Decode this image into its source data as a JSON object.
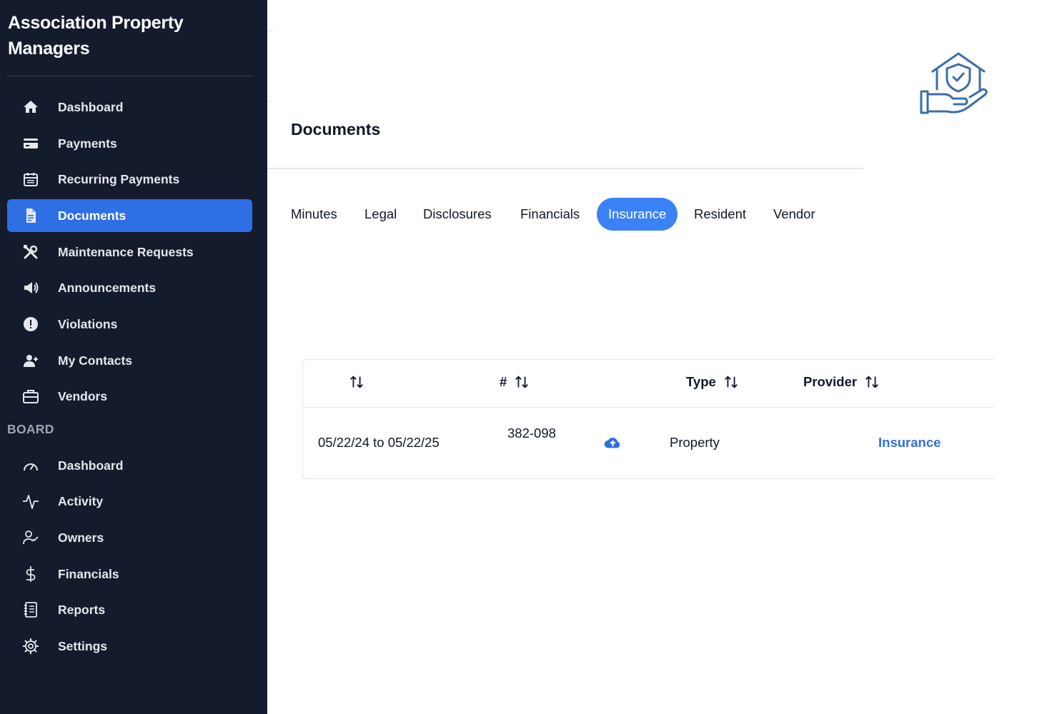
{
  "app": {
    "title": "Association Property Managers"
  },
  "sidebar": {
    "items": [
      {
        "label": "Dashboard",
        "icon": "home-icon"
      },
      {
        "label": "Payments",
        "icon": "credit-card-icon"
      },
      {
        "label": "Recurring Payments",
        "icon": "calendar-icon"
      },
      {
        "label": "Documents",
        "icon": "document-icon",
        "active": true
      },
      {
        "label": "Maintenance Requests",
        "icon": "wrench-screwdriver-icon"
      },
      {
        "label": "Announcements",
        "icon": "megaphone-icon"
      },
      {
        "label": "Violations",
        "icon": "alert-circle-icon"
      },
      {
        "label": "My Contacts",
        "icon": "user-plus-icon"
      },
      {
        "label": "Vendors",
        "icon": "briefcase-icon"
      }
    ],
    "board_section_label": "BOARD",
    "board_items": [
      {
        "label": "Dashboard",
        "icon": "gauge-icon"
      },
      {
        "label": "Activity",
        "icon": "activity-icon"
      },
      {
        "label": "Owners",
        "icon": "user-check-icon"
      },
      {
        "label": "Financials",
        "icon": "dollar-icon"
      },
      {
        "label": "Reports",
        "icon": "notebook-icon"
      },
      {
        "label": "Settings",
        "icon": "gear-icon"
      }
    ]
  },
  "main": {
    "page_title": "Documents",
    "tabs": [
      {
        "label": "Minutes"
      },
      {
        "label": "Legal"
      },
      {
        "label": "Disclosures"
      },
      {
        "label": "Financials"
      },
      {
        "label": "Insurance",
        "active": true
      },
      {
        "label": "Resident"
      },
      {
        "label": "Vendor"
      }
    ],
    "table": {
      "columns": [
        "",
        "#",
        "Type",
        "Provider"
      ],
      "rows": [
        {
          "date_range": "05/22/24 to 05/22/25",
          "number": "382-098",
          "type": "Property",
          "provider": "Insurance"
        }
      ]
    }
  },
  "colors": {
    "sidebar_bg": "#141b2d",
    "active_nav": "#2f6fe4",
    "active_tab": "#3b82f6",
    "link": "#2f6fe4",
    "hero_icon": "#3a6ea8"
  }
}
